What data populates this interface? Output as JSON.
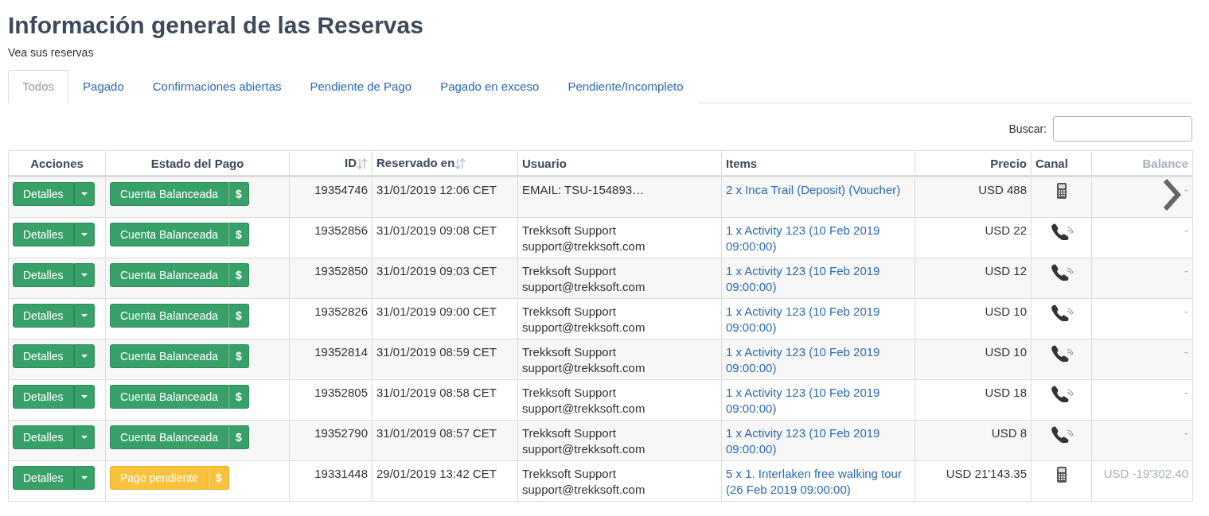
{
  "header": {
    "title": "Información general de las Reservas",
    "subtitle": "Vea sus reservas"
  },
  "tabs": [
    {
      "label": "Todos",
      "selected": true
    },
    {
      "label": "Pagado",
      "selected": false
    },
    {
      "label": "Confirmaciones abiertas",
      "selected": false
    },
    {
      "label": "Pendiente de Pago",
      "selected": false
    },
    {
      "label": "Pagado en exceso",
      "selected": false
    },
    {
      "label": "Pendiente/Incompleto",
      "selected": false
    }
  ],
  "search": {
    "label": "Buscar:"
  },
  "table": {
    "columns": [
      {
        "label": "Acciones",
        "sortable": false,
        "disabled": false
      },
      {
        "label": "Estado del Pago",
        "sortable": false,
        "disabled": false
      },
      {
        "label": "ID",
        "sortable": true,
        "disabled": false
      },
      {
        "label": "Reservado en",
        "sortable": true,
        "disabled": false
      },
      {
        "label": "Usuario",
        "sortable": false,
        "disabled": false
      },
      {
        "label": "Items",
        "sortable": false,
        "disabled": false
      },
      {
        "label": "Precio",
        "sortable": false,
        "disabled": false
      },
      {
        "label": "Canal",
        "sortable": false,
        "disabled": false
      },
      {
        "label": "Balance",
        "sortable": false,
        "disabled": true
      }
    ],
    "rows": [
      {
        "action": "Detalles",
        "status": {
          "kind": "balanced",
          "label": "Cuenta Balanceada",
          "icon": "$"
        },
        "id": "19354746",
        "date": "31/01/2019 12:06 CET",
        "user": [
          "EMAIL: TSU-154893…"
        ],
        "item": "2 x Inca Trail (Deposit) (Voucher)",
        "price": "USD 488",
        "channel": {
          "kind": "terminal"
        },
        "balance": "-"
      },
      {
        "action": "Detalles",
        "status": {
          "kind": "balanced",
          "label": "Cuenta Balanceada",
          "icon": "$"
        },
        "id": "19352856",
        "date": "31/01/2019 09:08 CET",
        "user": [
          "Trekksoft Support",
          "support@trekksoft.com"
        ],
        "item": "1 x Activity 123 (10 Feb 2019 09:00:00)",
        "price": "USD 22",
        "channel": {
          "kind": "phone"
        },
        "balance": "-"
      },
      {
        "action": "Detalles",
        "status": {
          "kind": "balanced",
          "label": "Cuenta Balanceada",
          "icon": "$"
        },
        "id": "19352850",
        "date": "31/01/2019 09:03 CET",
        "user": [
          "Trekksoft Support",
          "support@trekksoft.com"
        ],
        "item": "1 x Activity 123 (10 Feb 2019 09:00:00)",
        "price": "USD 12",
        "channel": {
          "kind": "phone"
        },
        "balance": "-"
      },
      {
        "action": "Detalles",
        "status": {
          "kind": "balanced",
          "label": "Cuenta Balanceada",
          "icon": "$"
        },
        "id": "19352826",
        "date": "31/01/2019 09:00 CET",
        "user": [
          "Trekksoft Support",
          "support@trekksoft.com"
        ],
        "item": "1 x Activity 123 (10 Feb 2019 09:00:00)",
        "price": "USD 10",
        "channel": {
          "kind": "phone"
        },
        "balance": "-"
      },
      {
        "action": "Detalles",
        "status": {
          "kind": "balanced",
          "label": "Cuenta Balanceada",
          "icon": "$"
        },
        "id": "19352814",
        "date": "31/01/2019 08:59 CET",
        "user": [
          "Trekksoft Support",
          "support@trekksoft.com"
        ],
        "item": "1 x Activity 123 (10 Feb 2019 09:00:00)",
        "price": "USD 10",
        "channel": {
          "kind": "phone"
        },
        "balance": "-"
      },
      {
        "action": "Detalles",
        "status": {
          "kind": "balanced",
          "label": "Cuenta Balanceada",
          "icon": "$"
        },
        "id": "19352805",
        "date": "31/01/2019 08:58 CET",
        "user": [
          "Trekksoft Support",
          "support@trekksoft.com"
        ],
        "item": "1 x Activity 123 (10 Feb 2019 09:00:00)",
        "price": "USD 18",
        "channel": {
          "kind": "phone"
        },
        "balance": "-"
      },
      {
        "action": "Detalles",
        "status": {
          "kind": "balanced",
          "label": "Cuenta Balanceada",
          "icon": "$"
        },
        "id": "19352790",
        "date": "31/01/2019 08:57 CET",
        "user": [
          "Trekksoft Support",
          "support@trekksoft.com"
        ],
        "item": "1 x Activity 123 (10 Feb 2019 09:00:00)",
        "price": "USD 8",
        "channel": {
          "kind": "phone"
        },
        "balance": "-"
      },
      {
        "action": "Detalles",
        "status": {
          "kind": "pending",
          "label": "Pago pendiente",
          "icon": "$"
        },
        "id": "19331448",
        "date": "29/01/2019 13:42 CET",
        "user": [
          "Trekksoft Support",
          "support@trekksoft.com"
        ],
        "item": "5 x 1. Interlaken free walking tour (26 Feb 2019 09:00:00)",
        "price": "USD 21'143.35",
        "channel": {
          "kind": "terminal"
        },
        "balance": "USD -19'302.40"
      }
    ]
  }
}
